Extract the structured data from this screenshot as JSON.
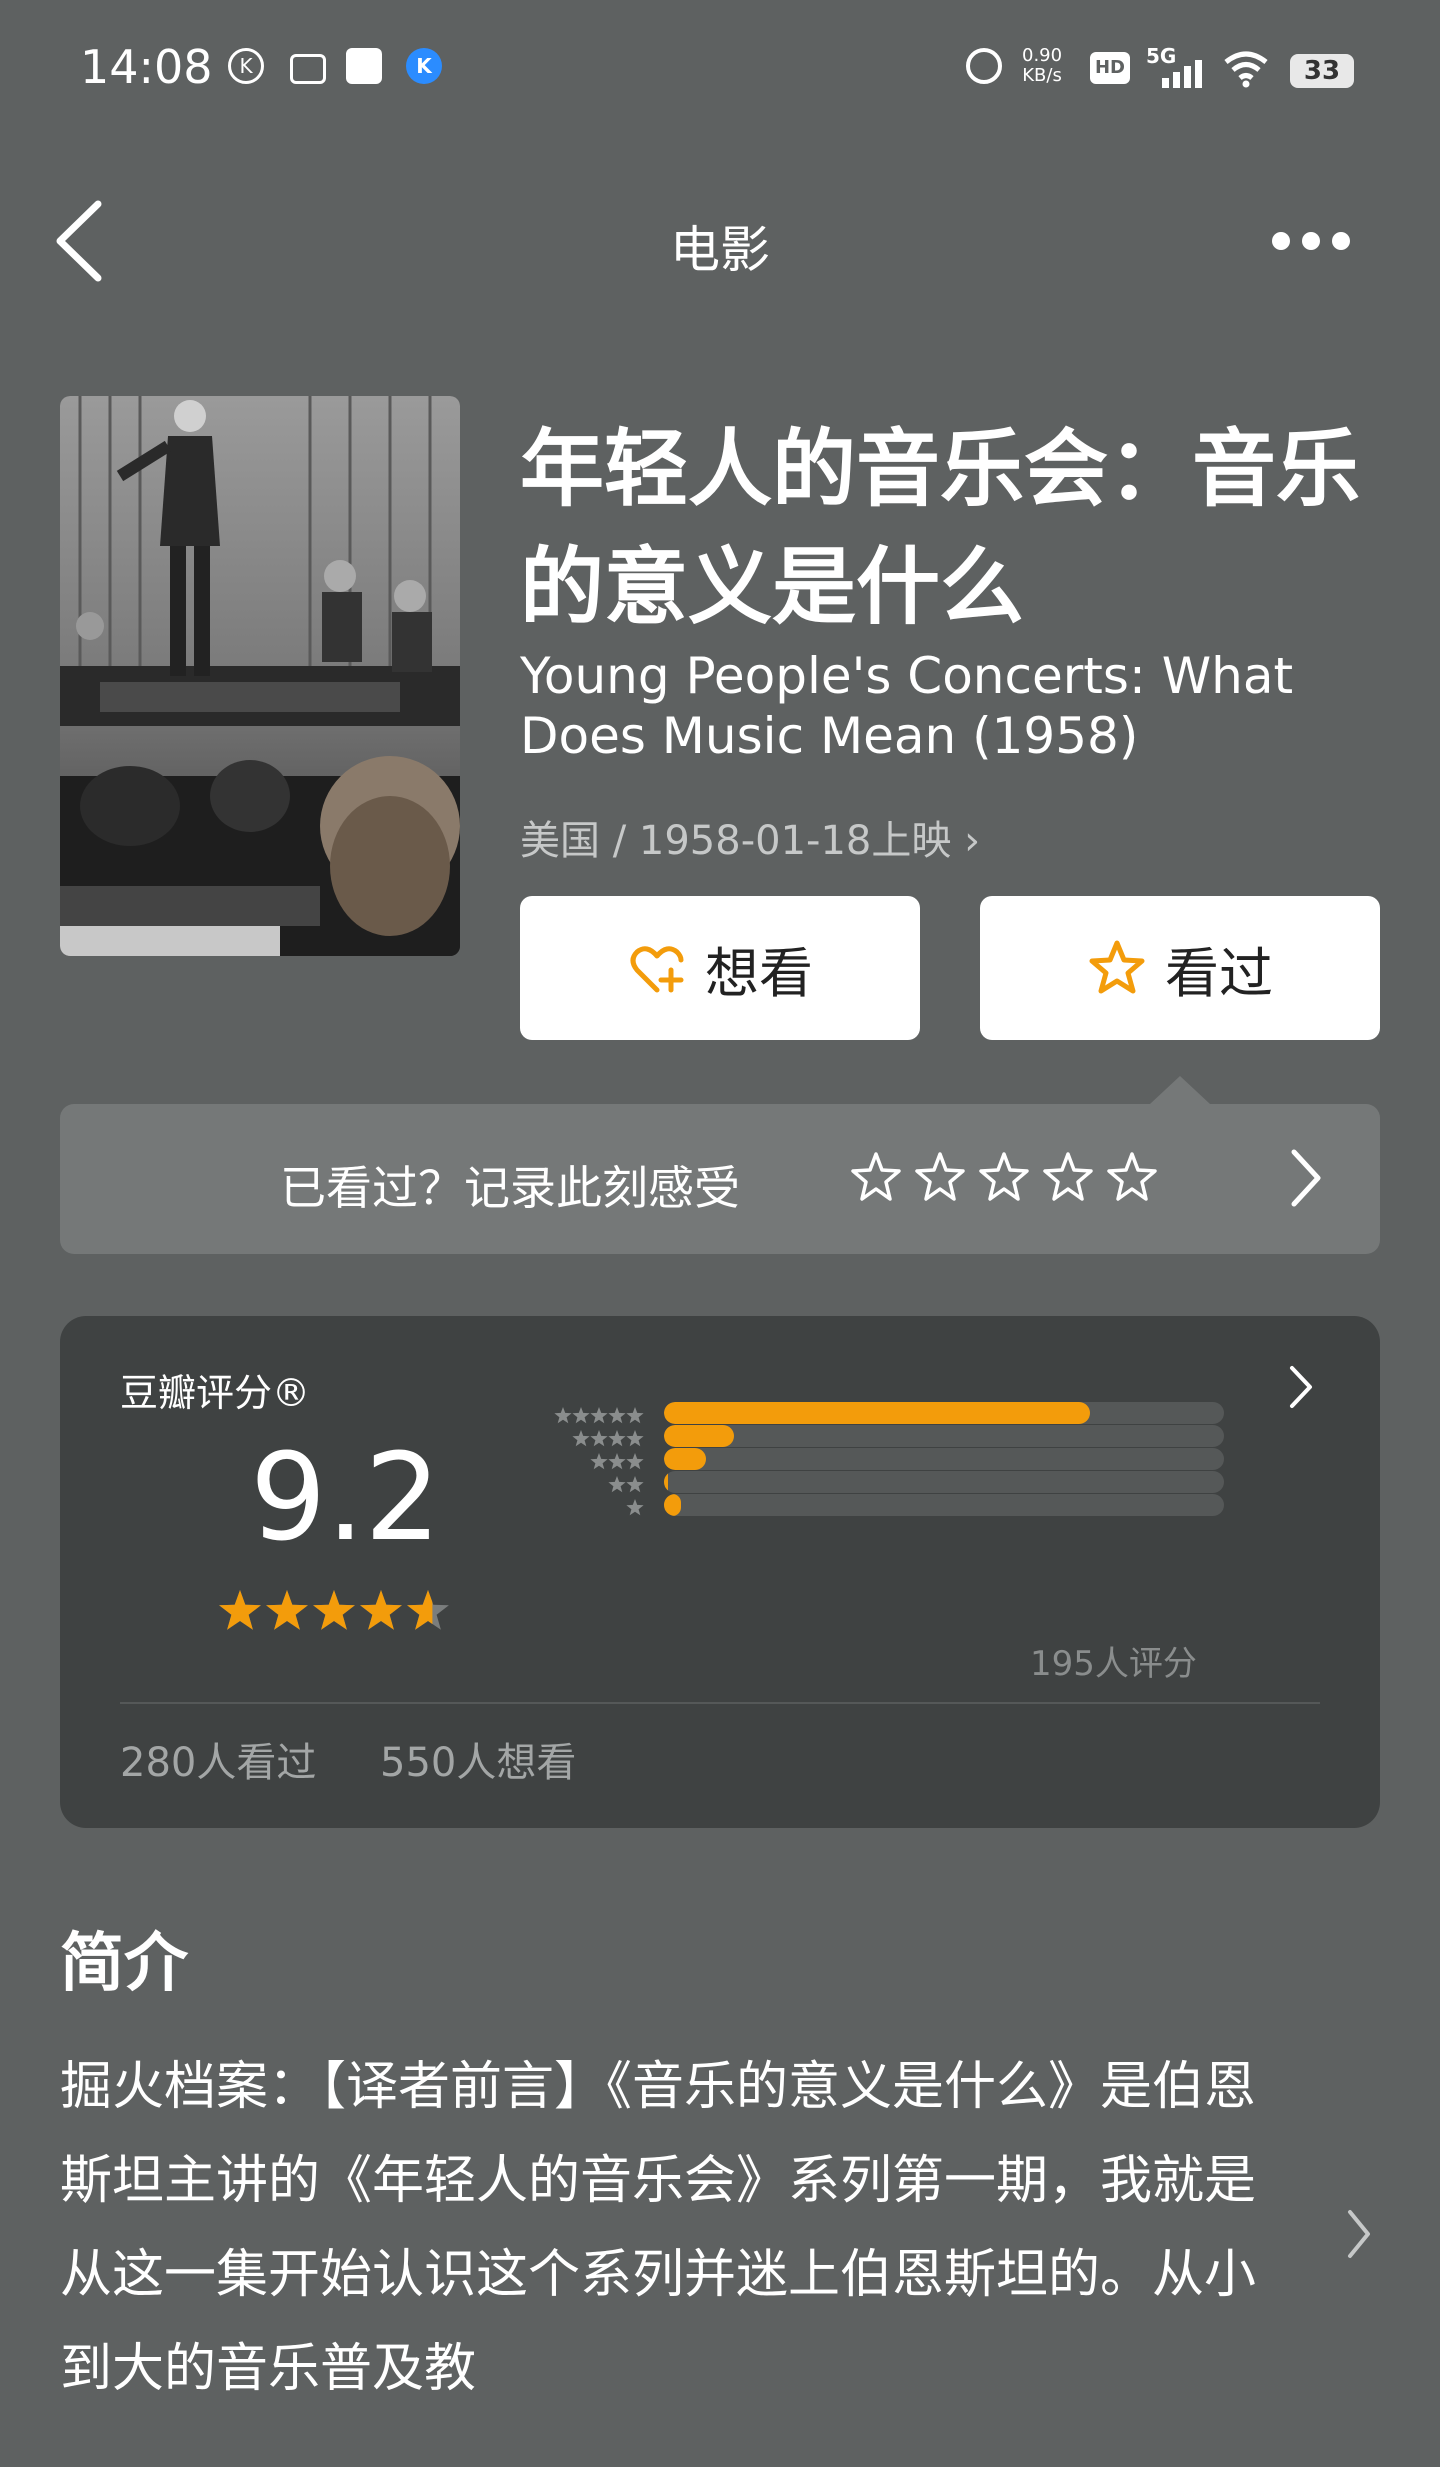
{
  "status_bar": {
    "time": "14:08",
    "net_speed_value": "0.90",
    "net_speed_unit": "KB/s",
    "hd_label": "HD",
    "network_label": "5G",
    "battery": "33",
    "k_badge_label": "K"
  },
  "header": {
    "title": "电影"
  },
  "movie": {
    "title": "年轻人的音乐会：音乐的意义是什么",
    "original_title": "Young People's Concerts: What Does Music Mean (1958)",
    "meta": "美国 / 1958-01-18上映 ›"
  },
  "actions": {
    "want_label": "想看",
    "seen_label": "看过"
  },
  "record": {
    "prompt": "已看过？记录此刻感受"
  },
  "rating": {
    "label": "豆瓣评分®",
    "score": "9.2",
    "score_value": 9.2,
    "distribution": [
      {
        "stars": 5,
        "fraction": 0.76
      },
      {
        "stars": 4,
        "fraction": 0.125
      },
      {
        "stars": 3,
        "fraction": 0.075
      },
      {
        "stars": 2,
        "fraction": 0.008
      },
      {
        "stars": 1,
        "fraction": 0.03
      }
    ],
    "rating_count": "195人评分",
    "seen_count": "280人看过",
    "want_count": "550人想看"
  },
  "intro": {
    "heading": "简介",
    "text": "掘火档案：【译者前言】《音乐的意义是什么》是伯恩斯坦主讲的《年轻人的音乐会》系列第一期，我就是从这一集开始认识这个系列并迷上伯恩斯坦的。从小到大的音乐普及教"
  },
  "colors": {
    "background": "#5e6161",
    "accent_orange": "#f39c0b",
    "card_dark": "#3f4242"
  }
}
